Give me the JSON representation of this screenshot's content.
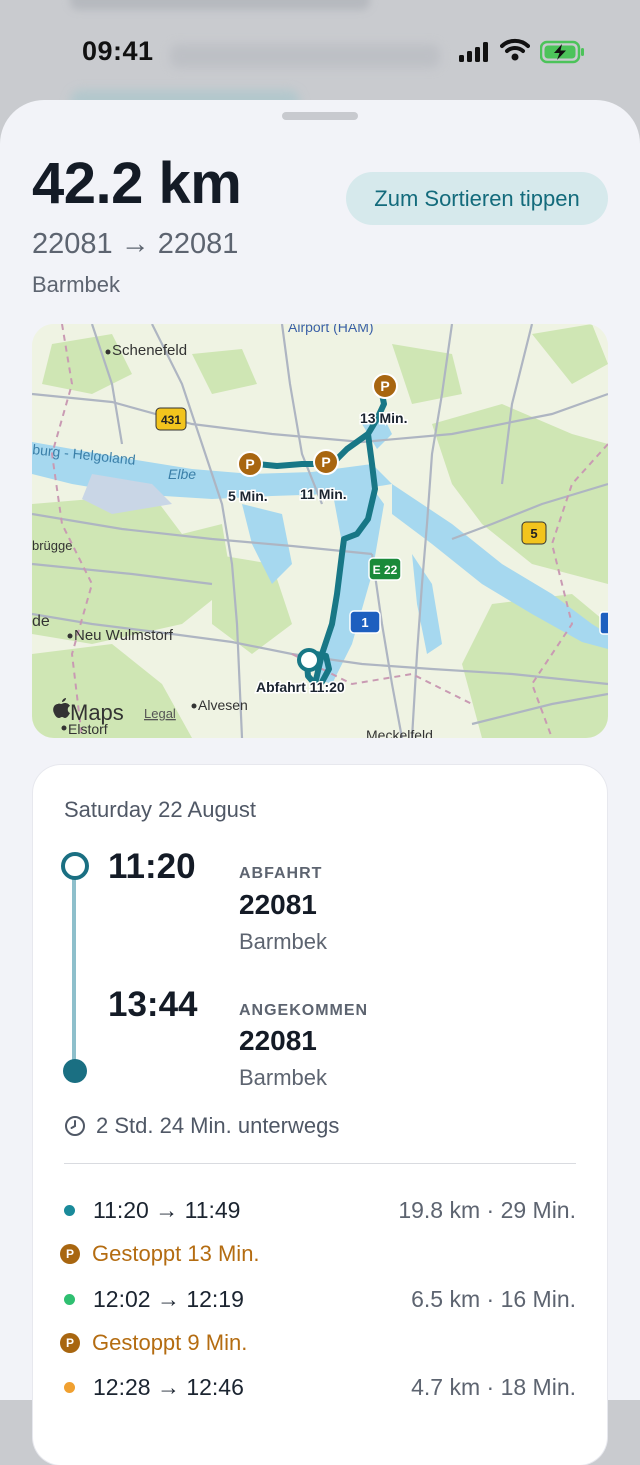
{
  "status_bar": {
    "time": "09:41"
  },
  "summary": {
    "distance": "42.2 km",
    "sort_button": "Zum Sortieren tippen",
    "route": "22081 → 22081",
    "district": "Barmbek"
  },
  "map": {
    "labels": {
      "airport": "Airport (HAM)",
      "schenefeld": "Schenefeld",
      "helgoland": "burg - Helgoland",
      "elbe": "Elbe",
      "bruegge": "brügge",
      "de": "de",
      "neu_wulmstorf": "Neu Wulmstorf",
      "alvesen": "Alvesen",
      "elstorf": "Elstorf",
      "meckelfeld": "Meckelfeld",
      "maps": "Maps",
      "legal": "Legal",
      "departure": "Abfahrt 11:20",
      "stop_5": "5 Min.",
      "stop_11": "11 Min.",
      "stop_13": "13 Min."
    },
    "shields": {
      "b431": "431",
      "a5": "5",
      "e22": "E 22",
      "a1": "1"
    },
    "parking_glyph": "P"
  },
  "trip": {
    "date": "Saturday 22 August",
    "start": {
      "time": "11:20",
      "label": "ABFAHRT",
      "zip": "22081",
      "district": "Barmbek"
    },
    "end": {
      "time": "13:44",
      "label": "ANGEKOMMEN",
      "zip": "22081",
      "district": "Barmbek"
    },
    "duration": "2 Std. 24 Min. unterwegs",
    "segments": [
      {
        "times": "11:20 → 11:49",
        "meta": "19.8 km · 29 Min.",
        "color": "#1a8a9a"
      },
      {
        "stop": "Gestoppt 13 Min."
      },
      {
        "times": "12:02 → 12:19",
        "meta": "6.5 km · 16 Min.",
        "color": "#2fbf71"
      },
      {
        "stop": "Gestoppt 9 Min."
      },
      {
        "times": "12:28 → 12:46",
        "meta": "4.7 km · 18 Min.",
        "color": "#f0a030"
      }
    ],
    "stop_glyph": "P"
  }
}
